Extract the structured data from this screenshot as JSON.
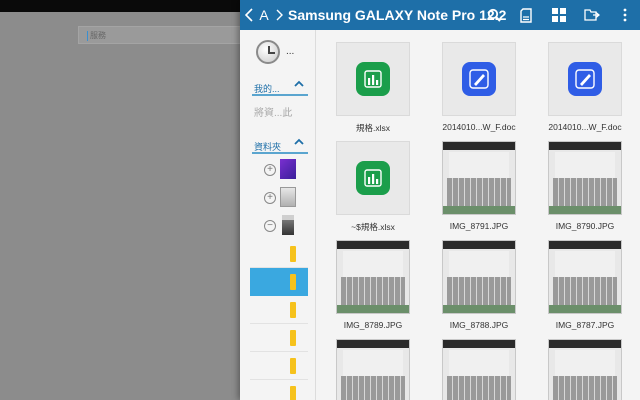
{
  "background_app": {
    "input_placeholder": "服務"
  },
  "header": {
    "title": "Samsung GALAXY Note Pro 12.2",
    "letter": "A",
    "color": "#1e6fa8"
  },
  "sidebar": {
    "recent_label": "...",
    "my_section": {
      "label": "我的...",
      "hint": "將資...此"
    },
    "folder_section": {
      "label": "資料夾"
    },
    "tree_items": [
      {
        "toggle": "+",
        "icon": "purple-storage-icon"
      },
      {
        "toggle": "+",
        "icon": "sd-card-icon"
      },
      {
        "toggle": "−",
        "icon": "usb-drive-icon"
      }
    ],
    "selected_folder_index": 1
  },
  "files": [
    {
      "name": "規格.xlsx",
      "type": "xls"
    },
    {
      "name": "2014010...W_F.doc",
      "type": "doc"
    },
    {
      "name": "2014010...W_F.doc",
      "type": "doc"
    },
    {
      "name": "~$規格.xlsx",
      "type": "xls"
    },
    {
      "name": "IMG_8791.JPG",
      "type": "photo"
    },
    {
      "name": "IMG_8790.JPG",
      "type": "photo"
    },
    {
      "name": "IMG_8789.JPG",
      "type": "photo"
    },
    {
      "name": "IMG_8788.JPG",
      "type": "photo"
    },
    {
      "name": "IMG_8787.JPG",
      "type": "photo"
    },
    {
      "name": "",
      "type": "photo"
    },
    {
      "name": "",
      "type": "photo"
    },
    {
      "name": "",
      "type": "photo"
    }
  ]
}
